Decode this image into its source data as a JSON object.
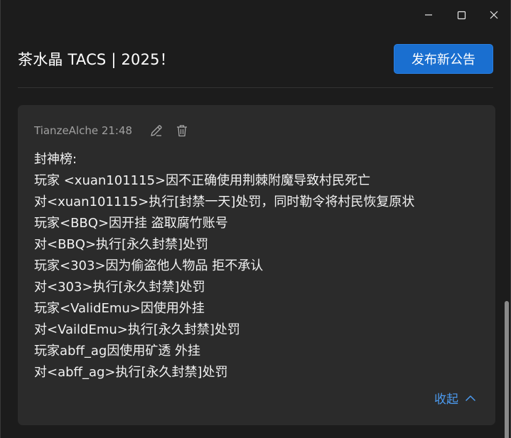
{
  "window": {
    "minimize_icon": "minimize-icon",
    "maximize_icon": "maximize-icon",
    "close_icon": "close-icon"
  },
  "header": {
    "title": "茶水晶 TACS | 2025！",
    "publish_label": "发布新公告"
  },
  "announcement": {
    "author_time": "TianzeAlche 21:48",
    "edit_icon": "pencil-icon",
    "delete_icon": "trash-icon",
    "lines": [
      "封神榜:",
      "玩家 <xuan101115>因不正确使用荆棘附魔导致村民死亡",
      "对<xuan101115>执行[封禁一天]处罚，同时勒令将村民恢复原状",
      "玩家<BBQ>因开挂 盗取腐竹账号",
      "对<BBQ>执行[永久封禁]处罚",
      "玩家<303>因为偷盗他人物品 拒不承认",
      "对<303>执行[永久封禁]处罚",
      "玩家<ValidEmu>因使用外挂",
      "对<VaildEmu>执行[永久封禁]处罚",
      "玩家abff_ag因使用矿透 外挂",
      "对<abff_ag>执行[永久封禁]处罚"
    ],
    "collapse_label": "收起"
  },
  "colors": {
    "accent": "#1a6fd0",
    "link": "#4c9bf0",
    "card_bg": "#2b2b2b",
    "window_bg": "#1c1c1c"
  }
}
